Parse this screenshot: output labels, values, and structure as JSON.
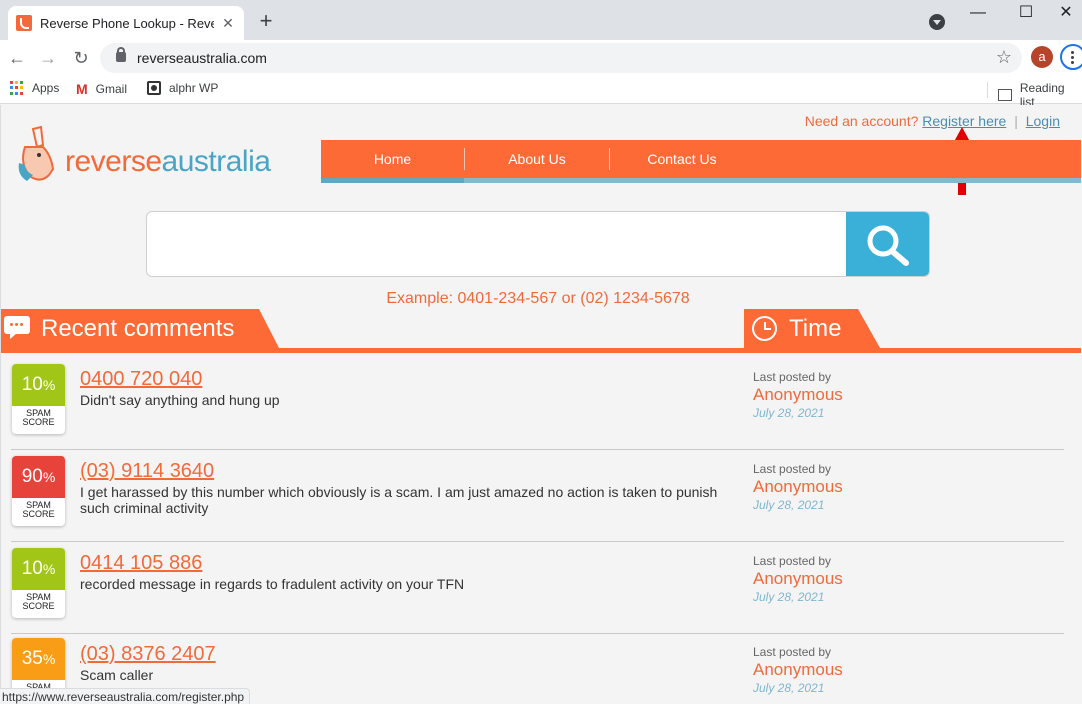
{
  "browser": {
    "tab_title": "Reverse Phone Lookup - Reverse",
    "tab_close": "✕",
    "new_tab": "+",
    "url": "reverseaustralia.com",
    "avatar_letter": "a",
    "window_buttons": [
      "—",
      "☐",
      "✕"
    ],
    "bookmarks": [
      "Apps",
      "Gmail",
      "alphr WP"
    ],
    "reading_list": "Reading list",
    "status_url": "https://www.reverseaustralia.com/register.php"
  },
  "site": {
    "logo_part1": "reverse",
    "logo_part2": "australia",
    "account_prompt": "Need an account?",
    "register_link": "Register here",
    "separator": "|",
    "login_link": "Login",
    "nav": [
      "Home",
      "About Us",
      "Contact Us"
    ],
    "search_placeholder": "",
    "example": "Example: 0401-234-567 or (02) 1234-5678",
    "recent_heading": "Recent comments",
    "time_heading": "Time",
    "accent_color": "#fe6a36",
    "secondary_color": "#48a5c6"
  },
  "comments": [
    {
      "score": "10",
      "score_color": "#a2c617",
      "number": "0400 720 040",
      "text": "Didn't say anything and hung up",
      "posted_label": "Last posted by",
      "author": "Anonymous",
      "date": "July 28, 2021"
    },
    {
      "score": "90",
      "score_color": "#e8433a",
      "number": "(03) 9114 3640",
      "text": "I get harassed by this number which obviously is a scam. I am just amazed no action is taken to punish such criminal activity",
      "posted_label": "Last posted by",
      "author": "Anonymous",
      "date": "July 28, 2021"
    },
    {
      "score": "10",
      "score_color": "#a2c617",
      "number": "0414 105 886",
      "text": "recorded message in regards to fradulent activity on your TFN",
      "posted_label": "Last posted by",
      "author": "Anonymous",
      "date": "July 28, 2021"
    },
    {
      "score": "35",
      "score_color": "#f99c16",
      "number": "(03) 8376 2407",
      "text": "Scam caller",
      "posted_label": "Last posted by",
      "author": "Anonymous",
      "date": "July 28, 2021"
    }
  ],
  "spam_label_line1": "SPAM",
  "spam_label_line2": "SCORE",
  "percent_sign": "%"
}
